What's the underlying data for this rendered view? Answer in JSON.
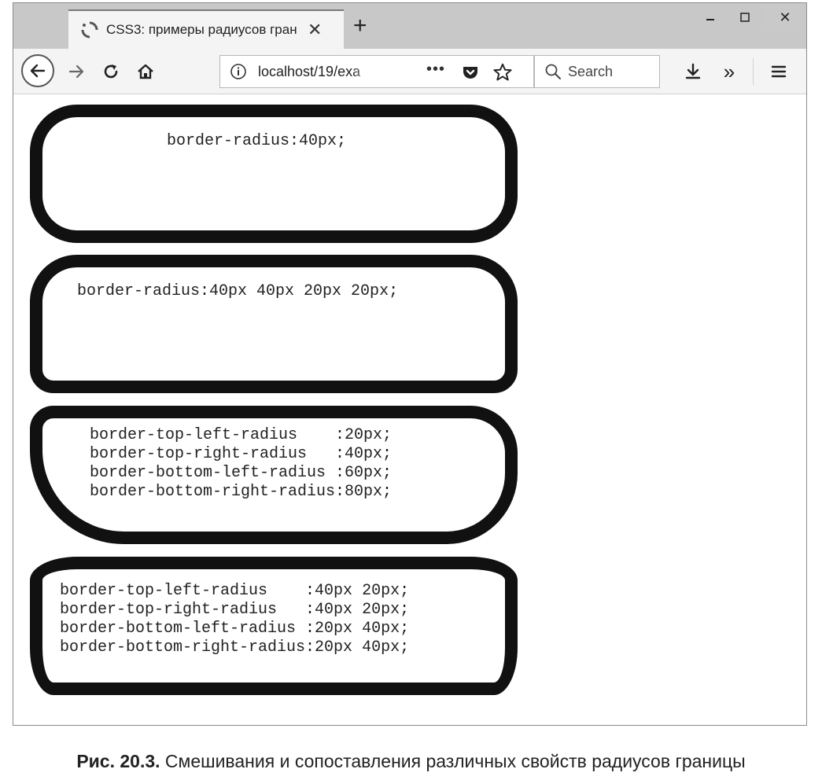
{
  "browser": {
    "tab_title": "CSS3: примеры радиусов гран",
    "tab_close": "✕",
    "new_tab": "+",
    "url": "localhost/19/exa",
    "url_more": "•••",
    "search_placeholder": "Search",
    "overflow": "»",
    "window_controls": {
      "minimize": "–",
      "maximize": "□",
      "close": "✕"
    }
  },
  "demos": [
    {
      "text": "border-radius:40px;"
    },
    {
      "text": "border-radius:40px 40px 20px 20px;"
    },
    {
      "text": "border-top-left-radius    :20px;\nborder-top-right-radius   :40px;\nborder-bottom-left-radius :60px;\nborder-bottom-right-radius:80px;"
    },
    {
      "text": "border-top-left-radius    :40px 20px;\nborder-top-right-radius   :40px 20px;\nborder-bottom-left-radius :20px 40px;\nborder-bottom-right-radius:20px 40px;"
    }
  ],
  "caption": {
    "label": "Рис. 20.3.",
    "text": " Смешивания и сопоставления различных свойств радиусов границы"
  }
}
